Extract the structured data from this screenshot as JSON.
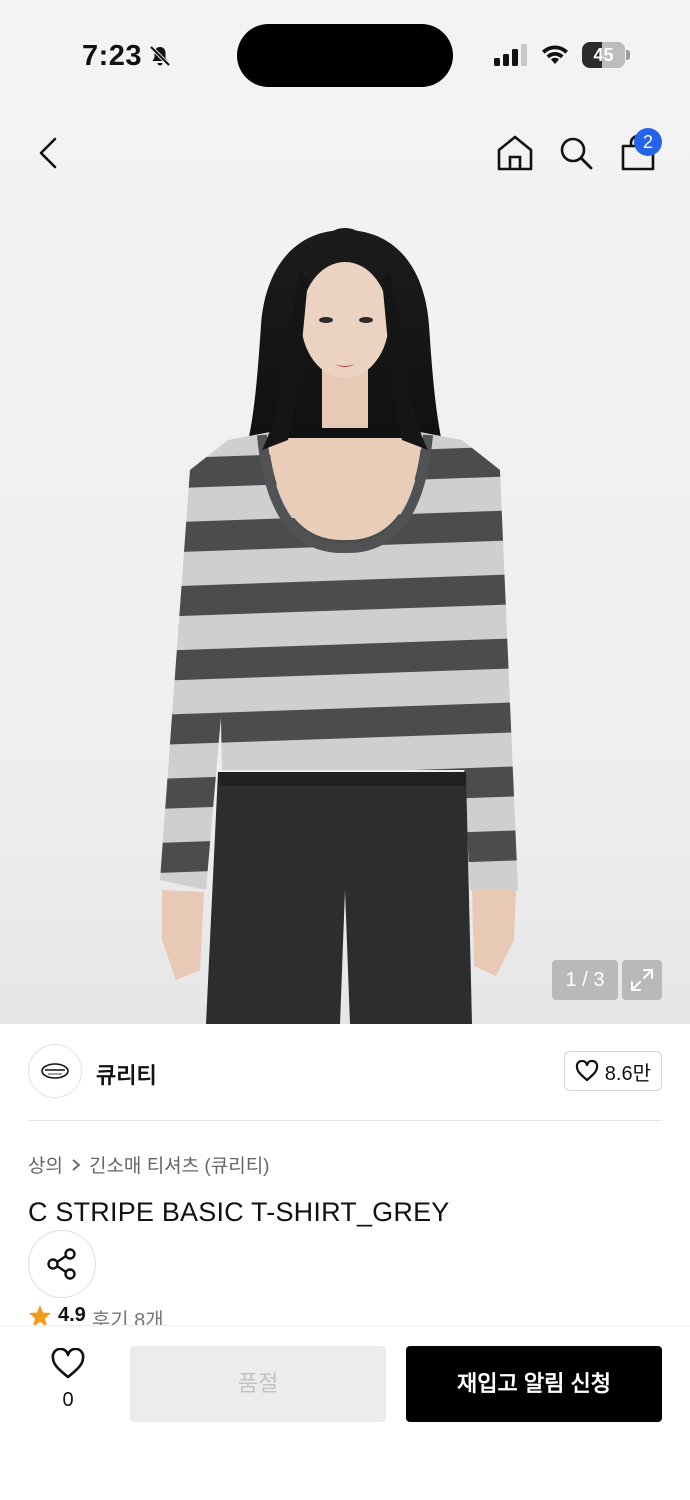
{
  "status_bar": {
    "time": "7:23",
    "battery": "45"
  },
  "nav": {
    "cart_count": "2",
    "icons": [
      "back-icon",
      "home-icon",
      "search-icon",
      "cart-icon"
    ]
  },
  "gallery": {
    "counter": "1 / 3"
  },
  "brand": {
    "name": "큐리티",
    "likes": "8.6만"
  },
  "breadcrumb": {
    "category": "상의",
    "subcategory": "긴소매 티셔츠 (큐리티)"
  },
  "product": {
    "title": "C STRIPE BASIC T-SHIRT_GREY",
    "rating": "4.9",
    "reviews": "후기 8개"
  },
  "bottom_bar": {
    "wish_count": "0",
    "soldout_label": "품절",
    "restock_label": "재입고 알림 신청"
  },
  "colors": {
    "badge": "#2563eb",
    "star": "#f29d1a",
    "primary_button": "#000000",
    "disabled_button": "#ececec"
  }
}
